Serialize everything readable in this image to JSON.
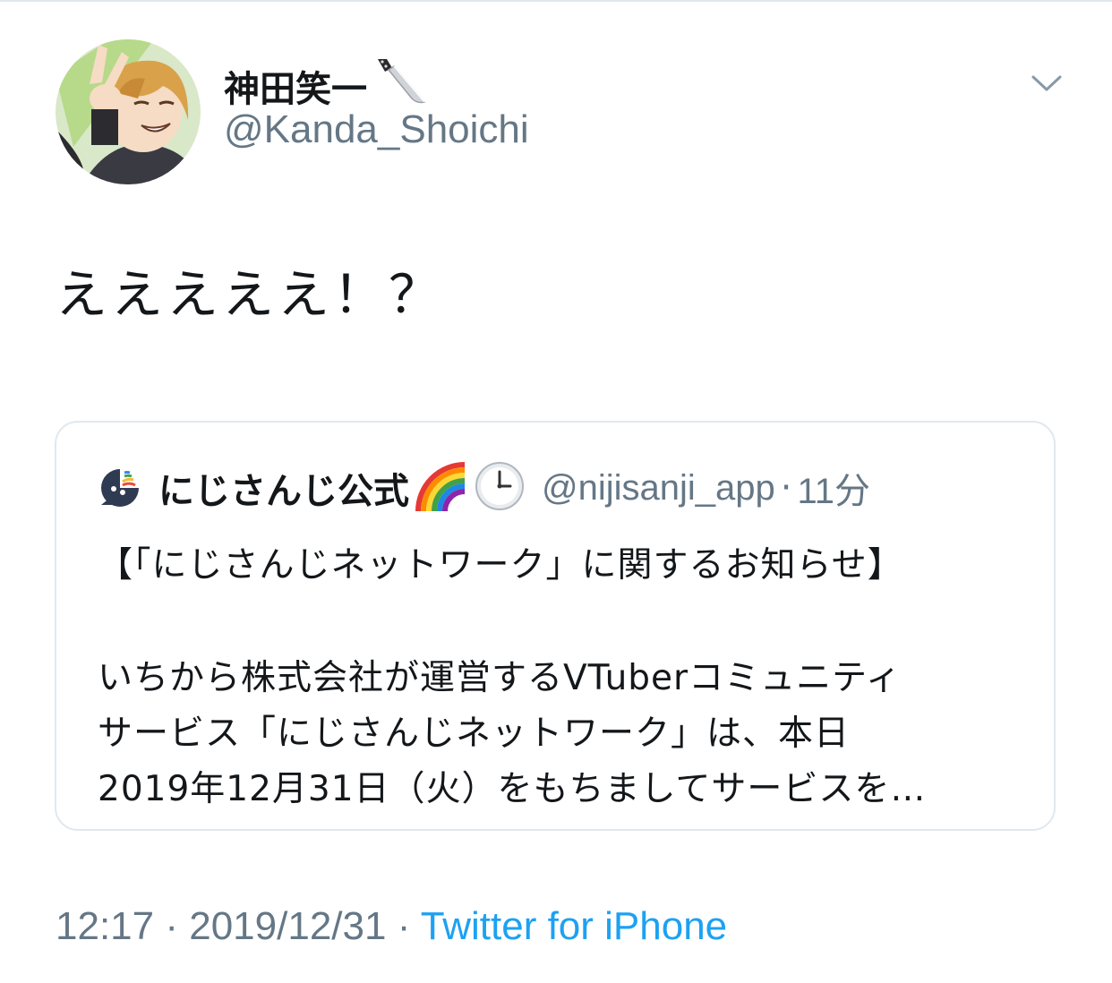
{
  "tweet": {
    "display_name": "神田笑一",
    "handle": "@Kanda_Shoichi",
    "text": "えええええ！？",
    "time": "12:17",
    "date": "2019/12/31",
    "separator": "·",
    "source": "Twitter for iPhone",
    "menu_icon": "chevron-down-icon",
    "name_emoji": "knife-icon"
  },
  "quote": {
    "display_name": "にじさんじ公式",
    "name_emojis": [
      "rainbow-icon",
      "clock-icon"
    ],
    "handle": "@nijisanji_app",
    "separator": "·",
    "time": "11分",
    "lines": [
      "【「にじさんじネットワーク」に関するお知らせ】",
      "いちから株式会社が運営するVTuberコミュニティ",
      "サービス「にじさんじネットワーク」は、本日",
      "2019年12月31日（火）をもちましてサービスを…"
    ]
  },
  "colors": {
    "text": "#14171a",
    "secondary": "#657786",
    "link": "#1da1f2",
    "border": "#e1e8ed"
  }
}
